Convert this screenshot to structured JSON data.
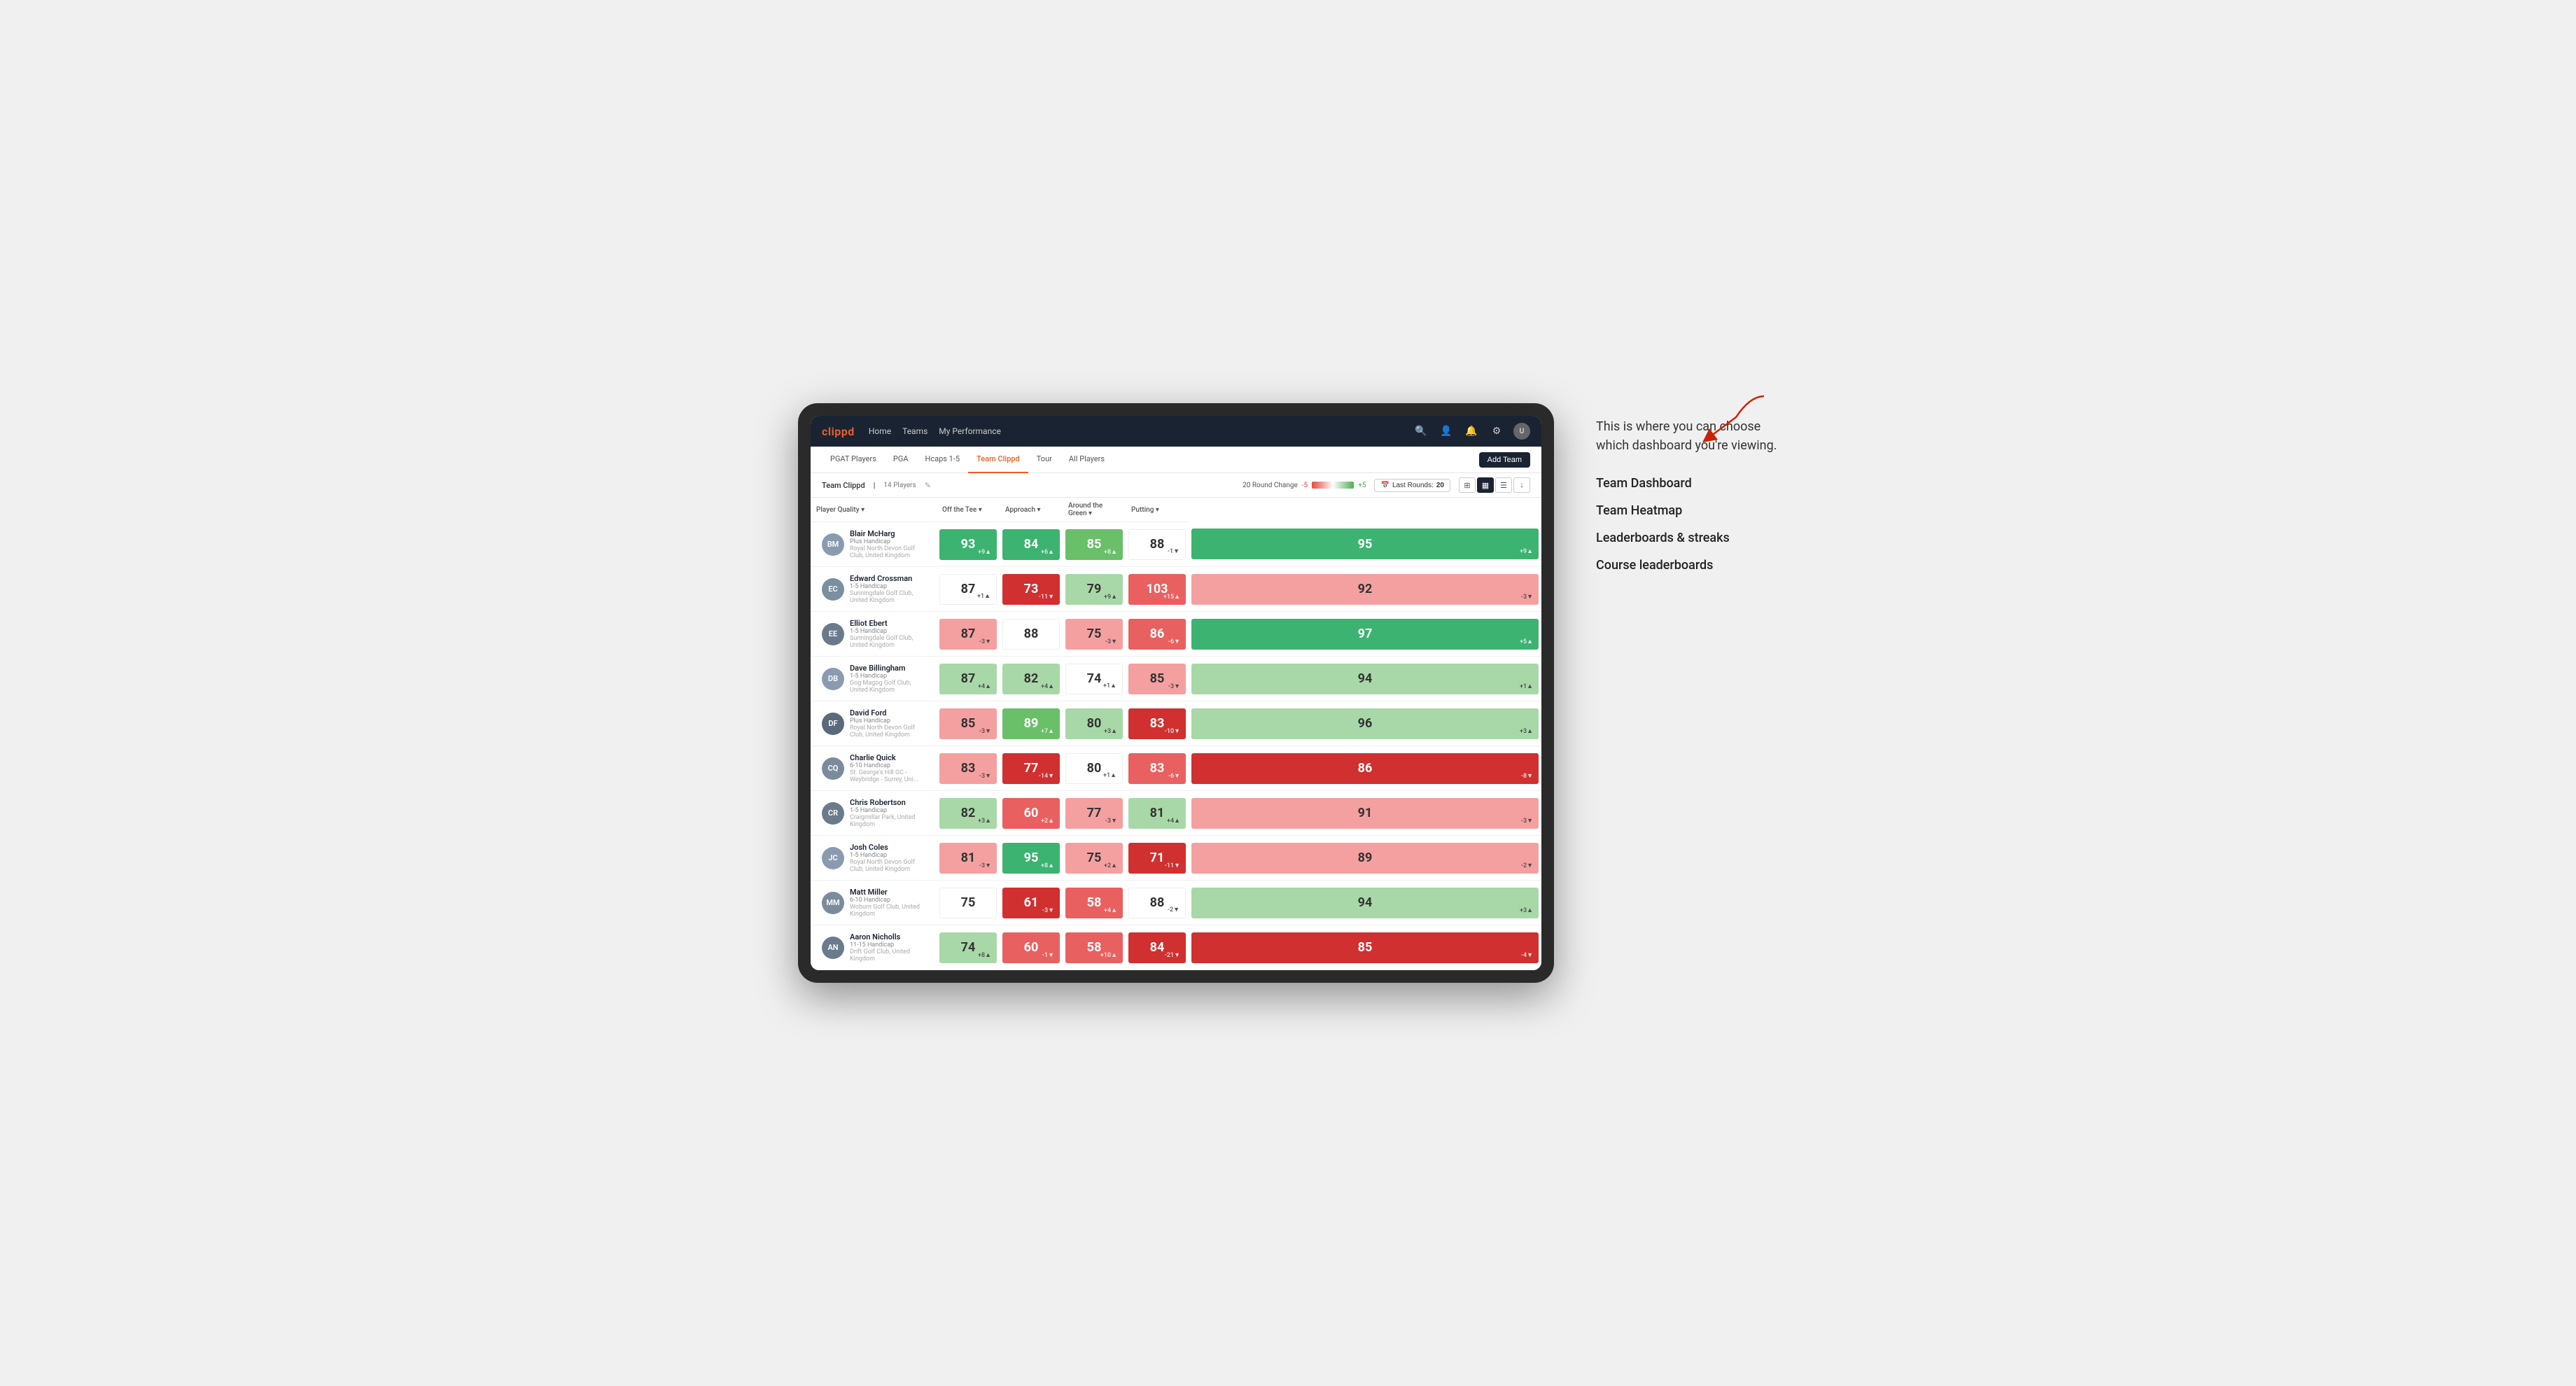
{
  "annotation": {
    "intro": "This is where you can choose which dashboard you're viewing.",
    "options": [
      "Team Dashboard",
      "Team Heatmap",
      "Leaderboards & streaks",
      "Course leaderboards"
    ]
  },
  "navbar": {
    "logo": "clippd",
    "links": [
      "Home",
      "Teams",
      "My Performance"
    ],
    "icons": [
      "search",
      "user",
      "bell",
      "settings",
      "avatar"
    ]
  },
  "subnav": {
    "tabs": [
      "PGAT Players",
      "PGA",
      "Hcaps 1-5",
      "Team Clippd",
      "Tour",
      "All Players"
    ],
    "active_tab": "Team Clippd",
    "add_team_label": "Add Team"
  },
  "team_header": {
    "team_name": "Team Clippd",
    "separator": "|",
    "player_count": "14 Players",
    "round_change_label": "20 Round Change",
    "range_neg": "-5",
    "range_pos": "+5",
    "last_rounds_label": "Last Rounds:",
    "last_rounds_value": "20"
  },
  "table": {
    "col_headers": [
      "Player Quality ▾",
      "Off the Tee ▾",
      "Approach ▾",
      "Around the Green ▾",
      "Putting ▾"
    ],
    "players": [
      {
        "name": "Blair McHarg",
        "handicap": "Plus Handicap",
        "club": "Royal North Devon Golf Club, United Kingdom",
        "initials": "BM",
        "color": "#8a9bb0",
        "scores": [
          {
            "value": 93,
            "change": "+9",
            "trend": "up",
            "bg": "green-strong"
          },
          {
            "value": 84,
            "change": "+6",
            "trend": "up",
            "bg": "green-strong"
          },
          {
            "value": 85,
            "change": "+8",
            "trend": "up",
            "bg": "green-medium"
          },
          {
            "value": 88,
            "change": "-1",
            "trend": "down",
            "bg": "white-bg"
          },
          {
            "value": 95,
            "change": "+9",
            "trend": "up",
            "bg": "green-strong"
          }
        ]
      },
      {
        "name": "Edward Crossman",
        "handicap": "1-5 Handicap",
        "club": "Sunningdale Golf Club, United Kingdom",
        "initials": "EC",
        "color": "#7a8fa0",
        "scores": [
          {
            "value": 87,
            "change": "+1",
            "trend": "up",
            "bg": "white-bg"
          },
          {
            "value": 73,
            "change": "-11",
            "trend": "down",
            "bg": "red-strong"
          },
          {
            "value": 79,
            "change": "+9",
            "trend": "up",
            "bg": "green-light"
          },
          {
            "value": 103,
            "change": "+15",
            "trend": "up",
            "bg": "red-medium"
          },
          {
            "value": 92,
            "change": "-3",
            "trend": "down",
            "bg": "red-light"
          }
        ]
      },
      {
        "name": "Elliot Ebert",
        "handicap": "1-5 Handicap",
        "club": "Sunningdale Golf Club, United Kingdom",
        "initials": "EE",
        "color": "#6a7a8a",
        "scores": [
          {
            "value": 87,
            "change": "-3",
            "trend": "down",
            "bg": "red-light"
          },
          {
            "value": 88,
            "change": "",
            "trend": "",
            "bg": "white-bg"
          },
          {
            "value": 75,
            "change": "-3",
            "trend": "down",
            "bg": "red-light"
          },
          {
            "value": 86,
            "change": "-6",
            "trend": "down",
            "bg": "red-medium"
          },
          {
            "value": 97,
            "change": "+5",
            "trend": "up",
            "bg": "green-strong"
          }
        ]
      },
      {
        "name": "Dave Billingham",
        "handicap": "1-5 Handicap",
        "club": "Gog Magog Golf Club, United Kingdom",
        "initials": "DB",
        "color": "#8a9bb0",
        "scores": [
          {
            "value": 87,
            "change": "+4",
            "trend": "up",
            "bg": "green-light"
          },
          {
            "value": 82,
            "change": "+4",
            "trend": "up",
            "bg": "green-light"
          },
          {
            "value": 74,
            "change": "+1",
            "trend": "up",
            "bg": "white-bg"
          },
          {
            "value": 85,
            "change": "-3",
            "trend": "down",
            "bg": "red-light"
          },
          {
            "value": 94,
            "change": "+1",
            "trend": "up",
            "bg": "green-light"
          }
        ]
      },
      {
        "name": "David Ford",
        "handicap": "Plus Handicap",
        "club": "Royal North Devon Golf Club, United Kingdom",
        "initials": "DF",
        "color": "#5a6a7a",
        "verified": true,
        "scores": [
          {
            "value": 85,
            "change": "-3",
            "trend": "down",
            "bg": "red-light"
          },
          {
            "value": 89,
            "change": "+7",
            "trend": "up",
            "bg": "green-medium"
          },
          {
            "value": 80,
            "change": "+3",
            "trend": "up",
            "bg": "green-light"
          },
          {
            "value": 83,
            "change": "-10",
            "trend": "down",
            "bg": "red-strong"
          },
          {
            "value": 96,
            "change": "+3",
            "trend": "up",
            "bg": "green-light"
          }
        ]
      },
      {
        "name": "Charlie Quick",
        "handicap": "6-10 Handicap",
        "club": "St. George's Hill GC - Weybridge - Surrey, Uni...",
        "initials": "CQ",
        "color": "#7a8b9c",
        "verified": true,
        "scores": [
          {
            "value": 83,
            "change": "-3",
            "trend": "down",
            "bg": "red-light"
          },
          {
            "value": 77,
            "change": "-14",
            "trend": "down",
            "bg": "red-strong"
          },
          {
            "value": 80,
            "change": "+1",
            "trend": "up",
            "bg": "white-bg"
          },
          {
            "value": 83,
            "change": "-6",
            "trend": "down",
            "bg": "red-medium"
          },
          {
            "value": 86,
            "change": "-8",
            "trend": "down",
            "bg": "red-strong"
          }
        ]
      },
      {
        "name": "Chris Robertson",
        "handicap": "1-5 Handicap",
        "club": "Craigmillar Park, United Kingdom",
        "initials": "CR",
        "color": "#6a7b8c",
        "verified": true,
        "scores": [
          {
            "value": 82,
            "change": "+3",
            "trend": "up",
            "bg": "green-light"
          },
          {
            "value": 60,
            "change": "+2",
            "trend": "up",
            "bg": "red-medium"
          },
          {
            "value": 77,
            "change": "-3",
            "trend": "down",
            "bg": "red-light"
          },
          {
            "value": 81,
            "change": "+4",
            "trend": "up",
            "bg": "green-light"
          },
          {
            "value": 91,
            "change": "-3",
            "trend": "down",
            "bg": "red-light"
          }
        ]
      },
      {
        "name": "Josh Coles",
        "handicap": "1-5 Handicap",
        "club": "Royal North Devon Golf Club, United Kingdom",
        "initials": "JC",
        "color": "#8a9bb0",
        "scores": [
          {
            "value": 81,
            "change": "-3",
            "trend": "down",
            "bg": "red-light"
          },
          {
            "value": 95,
            "change": "+8",
            "trend": "up",
            "bg": "green-strong"
          },
          {
            "value": 75,
            "change": "+2",
            "trend": "up",
            "bg": "red-light"
          },
          {
            "value": 71,
            "change": "-11",
            "trend": "down",
            "bg": "red-strong"
          },
          {
            "value": 89,
            "change": "-2",
            "trend": "down",
            "bg": "red-light"
          }
        ]
      },
      {
        "name": "Matt Miller",
        "handicap": "6-10 Handicap",
        "club": "Woburn Golf Club, United Kingdom",
        "initials": "MM",
        "color": "#7a8b9c",
        "scores": [
          {
            "value": 75,
            "change": "",
            "trend": "",
            "bg": "white-bg"
          },
          {
            "value": 61,
            "change": "-3",
            "trend": "down",
            "bg": "red-strong"
          },
          {
            "value": 58,
            "change": "+4",
            "trend": "up",
            "bg": "red-medium"
          },
          {
            "value": 88,
            "change": "-2",
            "trend": "down",
            "bg": "white-bg"
          },
          {
            "value": 94,
            "change": "+3",
            "trend": "up",
            "bg": "green-light"
          }
        ]
      },
      {
        "name": "Aaron Nicholls",
        "handicap": "11-15 Handicap",
        "club": "Drift Golf Club, United Kingdom",
        "initials": "AN",
        "color": "#6a7b8c",
        "scores": [
          {
            "value": 74,
            "change": "+8",
            "trend": "up",
            "bg": "green-light"
          },
          {
            "value": 60,
            "change": "-1",
            "trend": "down",
            "bg": "red-medium"
          },
          {
            "value": 58,
            "change": "+10",
            "trend": "up",
            "bg": "red-medium"
          },
          {
            "value": 84,
            "change": "-21",
            "trend": "down",
            "bg": "red-strong"
          },
          {
            "value": 85,
            "change": "-4",
            "trend": "down",
            "bg": "red-strong"
          }
        ]
      }
    ]
  }
}
